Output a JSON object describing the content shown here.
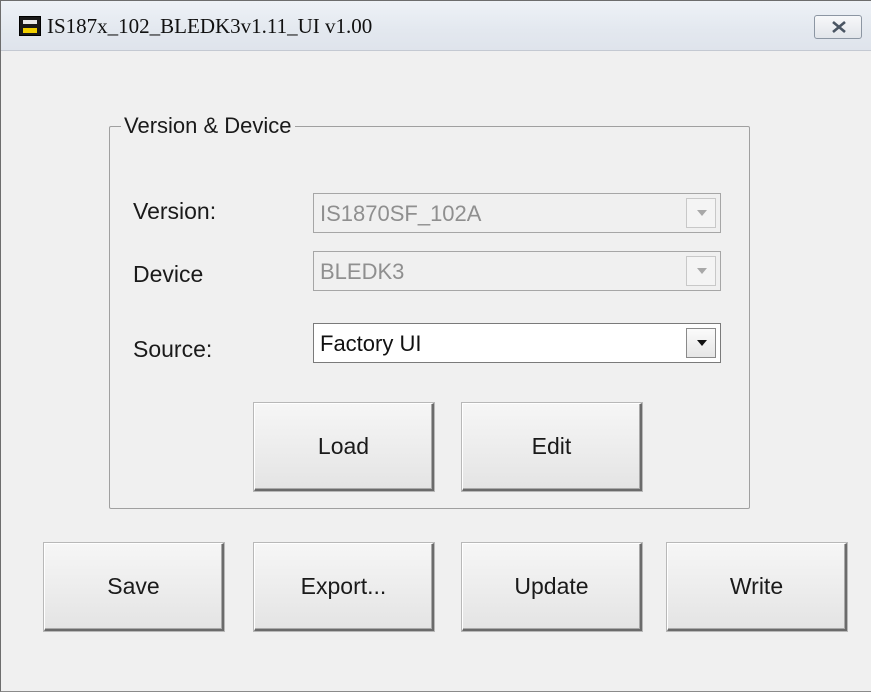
{
  "window": {
    "title": "IS187x_102_BLEDK3v1.11_UI v1.00",
    "close_label": "close"
  },
  "group": {
    "legend": "Version & Device",
    "fields": [
      {
        "label": "Version:",
        "value": "IS1870SF_102A",
        "enabled": false
      },
      {
        "label": "Device",
        "value": "BLEDK3",
        "enabled": false
      },
      {
        "label": "Source:",
        "value": "Factory UI",
        "enabled": true
      }
    ],
    "load_label": "Load",
    "edit_label": "Edit"
  },
  "actions": {
    "save_label": "Save",
    "export_label": "Export...",
    "update_label": "Update",
    "write_label": "Write"
  },
  "icons": {
    "app": "app-icon",
    "close": "close-icon",
    "dropdown": "chevron-down-icon"
  },
  "colors": {
    "window_bg": "#f0f0f0",
    "disabled_text": "#8f8f8f",
    "title_bar": "#e3e8ef"
  }
}
